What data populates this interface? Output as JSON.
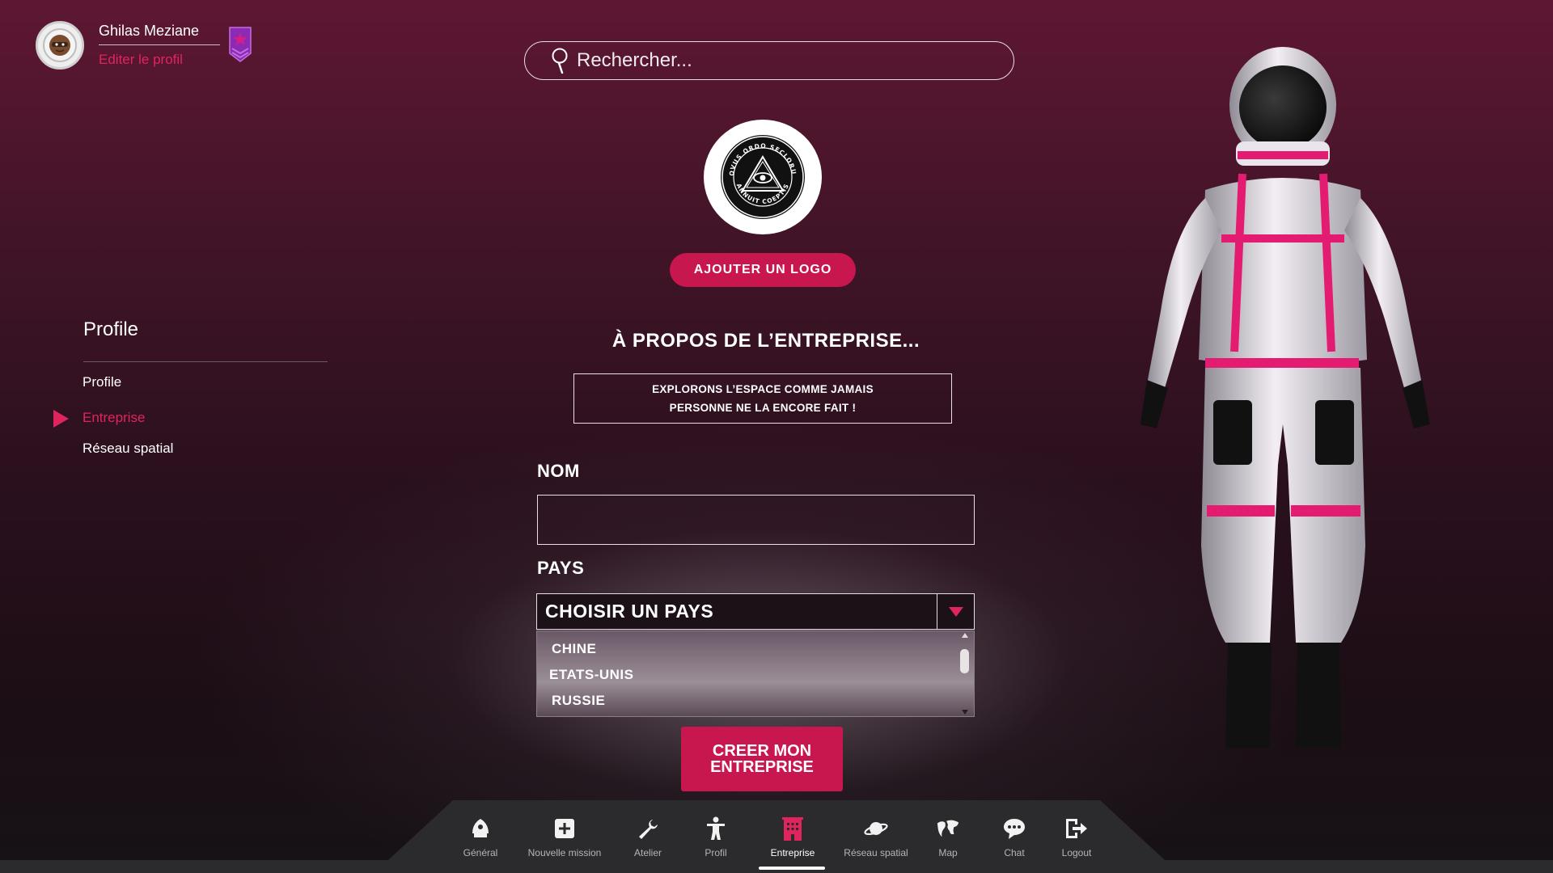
{
  "user": {
    "name": "Ghilas Meziane",
    "edit_label": "Editer le profil"
  },
  "search": {
    "placeholder": "Rechercher..."
  },
  "logo": {
    "seal_text_top": "NOVUS ORDO SECLORUM",
    "seal_text_bottom": "ANNUIT COEPTIS",
    "add_logo_label": "AJOUTER UN LOGO"
  },
  "sidebar": {
    "title": "Profile",
    "items": [
      {
        "label": "Profile",
        "active": false
      },
      {
        "label": "Entreprise",
        "active": true
      },
      {
        "label": "Réseau spatial",
        "active": false
      }
    ]
  },
  "form": {
    "about_title": "À PROPOS DE L’ENTREPRISE...",
    "slogan": "EXPLORONS L’ESPACE COMME JAMAIS\nPERSONNE NE LA ENCORE FAIT !",
    "name_label": "NOM",
    "name_value": "",
    "country_label": "PAYS",
    "country_selected": "CHOISIR UN PAYS",
    "country_options": [
      "CHINE",
      "ETATS-UNIS",
      "RUSSIE"
    ],
    "submit_label": "CREER MON\nENTREPRISE"
  },
  "bottom_nav": {
    "items": [
      {
        "label": "Général",
        "icon": "rocket-icon",
        "active": false
      },
      {
        "label": "Nouvelle mission",
        "icon": "plus-square-icon",
        "active": false
      },
      {
        "label": "Atelier",
        "icon": "wrench-icon",
        "active": false
      },
      {
        "label": "Profil",
        "icon": "person-icon",
        "active": false
      },
      {
        "label": "Entreprise",
        "icon": "building-icon",
        "active": true
      },
      {
        "label": "Réseau spatial",
        "icon": "planet-icon",
        "active": false
      },
      {
        "label": "Map",
        "icon": "map-icon",
        "active": false
      },
      {
        "label": "Chat",
        "icon": "chat-icon",
        "active": false
      },
      {
        "label": "Logout",
        "icon": "logout-icon",
        "active": false
      }
    ]
  },
  "colors": {
    "accent": "#c8164f",
    "accent_text": "#e0245e",
    "background_top": "#5e1733",
    "background_bottom": "#161215"
  }
}
